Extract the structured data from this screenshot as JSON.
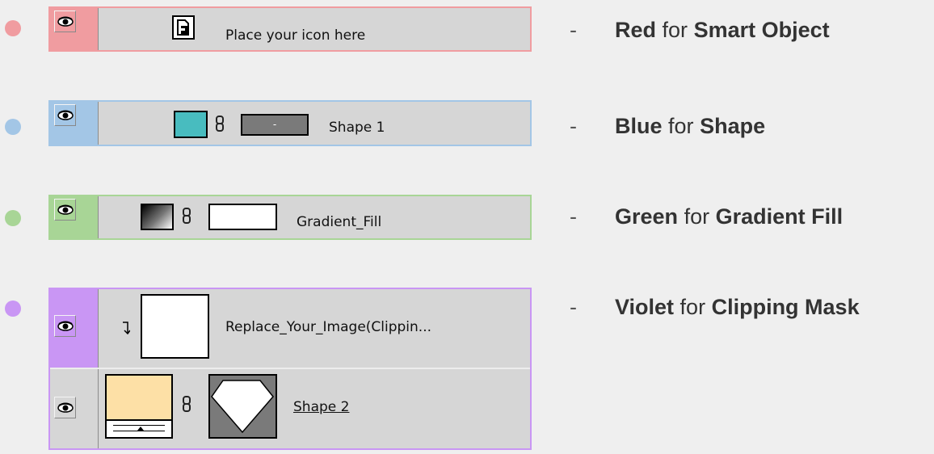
{
  "colors": {
    "background": "#efefef",
    "panel": "#d6d6d6",
    "red": "#f09ca0",
    "blue": "#a3c6e6",
    "green": "#a8d596",
    "violet": "#c996f4",
    "shape_fill": "#48bcbf",
    "skin_fill": "#fde0a6"
  },
  "layers": [
    {
      "name": "Place your icon here",
      "kind": "smart-object",
      "color": "red"
    },
    {
      "name": "Shape 1",
      "kind": "shape",
      "color": "blue",
      "mask_label": "-"
    },
    {
      "name": "Gradient_Fill",
      "kind": "gradient-fill",
      "color": "green"
    },
    {
      "name": "Replace_Your_Image(Clippin...",
      "kind": "clipped-layer",
      "color": "violet"
    },
    {
      "name": "Shape 2",
      "kind": "shape",
      "color": "violet"
    }
  ],
  "legend": [
    {
      "dash": "-",
      "color_word": "Red",
      "connector": "for",
      "type_name": "Smart Object"
    },
    {
      "dash": "-",
      "color_word": "Blue",
      "connector": "for",
      "type_name": "Shape"
    },
    {
      "dash": "-",
      "color_word": "Green",
      "connector": "for",
      "type_name": "Gradient Fill"
    },
    {
      "dash": "-",
      "color_word": "Violet",
      "connector": "for",
      "type_name": "Clipping Mask"
    }
  ],
  "icons": [
    "eye-icon",
    "smart-object-icon",
    "link-icon",
    "clip-arrow-icon",
    "vector-mask-icon"
  ]
}
